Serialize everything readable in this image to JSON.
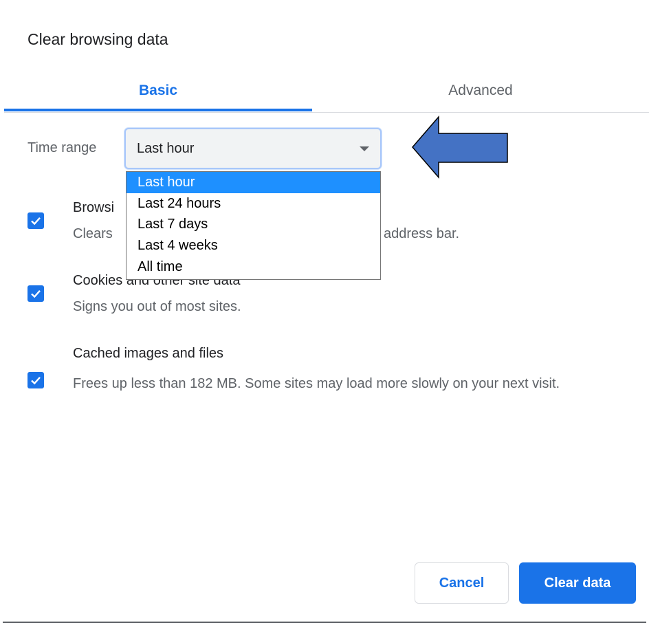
{
  "dialog": {
    "title": "Clear browsing data"
  },
  "tabs": [
    {
      "label": "Basic",
      "active": true
    },
    {
      "label": "Advanced",
      "active": false
    }
  ],
  "time_range": {
    "label": "Time range",
    "selected": "Last hour",
    "options": [
      "Last hour",
      "Last 24 hours",
      "Last 7 days",
      "Last 4 weeks",
      "All time"
    ],
    "dropdown_open": true
  },
  "items": [
    {
      "title": "Browsing history",
      "visible_title": "Browsi",
      "desc_start": "Clears",
      "desc_end": "address bar.",
      "checked": true
    },
    {
      "title": "Cookies and other site data",
      "desc": "Signs you out of most sites.",
      "checked": true
    },
    {
      "title": "Cached images and files",
      "desc": "Frees up less than 182 MB. Some sites may load more slowly on your next visit.",
      "checked": true
    }
  ],
  "buttons": {
    "cancel": "Cancel",
    "clear": "Clear data"
  },
  "annotation": {
    "type": "arrow-left",
    "color": "#4472c4"
  },
  "colors": {
    "accent": "#1a73e8",
    "selected_option": "#1e90ff"
  },
  "icons": {
    "caret": "caret-down-icon",
    "check": "check-icon"
  }
}
